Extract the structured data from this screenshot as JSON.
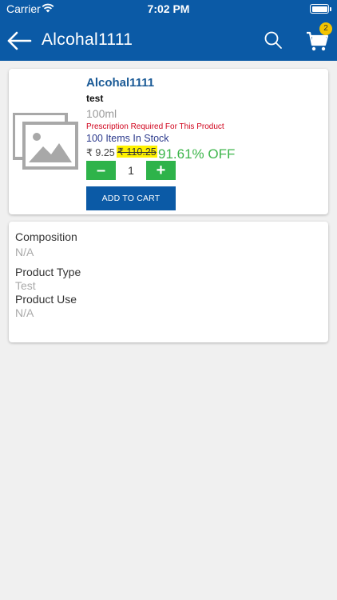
{
  "status_bar": {
    "carrier": "Carrier",
    "time": "7:02 PM"
  },
  "header": {
    "title": "Alcohal1111",
    "cart_count": "2",
    "color": "#0b5aa6",
    "icons": [
      "back-arrow-icon",
      "search-icon",
      "cart-icon"
    ]
  },
  "product": {
    "name": "Alcohal1111",
    "brand": "test",
    "pack": "100ml",
    "prescription_note": "Prescription Required For This Product",
    "stock": "100 Items In Stock",
    "price": "₹ 9.25",
    "mrp": "₹ 110.25",
    "discount": "91.61% OFF",
    "quantity": "1",
    "minus_label": "–",
    "plus_label": "+",
    "add_to_cart": "ADD TO CART"
  },
  "details": {
    "composition_label": "Composition",
    "composition_value": "N/A",
    "type_label": "Product Type",
    "type_value": "Test",
    "use_label": "Product Use",
    "use_value": "N/A"
  },
  "colors": {
    "primary": "#0b5aa6",
    "green": "#2eb34a",
    "discount": "#3cb54a",
    "prescription": "#d0021b",
    "highlight": "#fff200"
  }
}
